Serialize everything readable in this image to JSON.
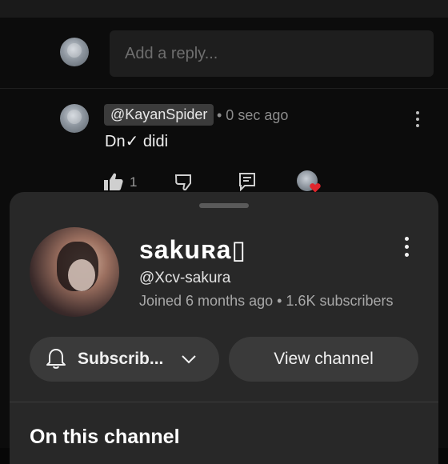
{
  "reply": {
    "placeholder": "Add a reply..."
  },
  "comment": {
    "author": "@KayanSpider",
    "time": "• 0 sec ago",
    "text": "Dn✓ didi",
    "like_count": "1"
  },
  "channel_sheet": {
    "name": "sakuʀa▯",
    "handle": "@Xcv-sakura",
    "meta": "Joined 6 months ago • 1.6K subscribers",
    "subscribe_label": "Subscrib...",
    "view_channel_label": "View channel",
    "section_title": "On this channel"
  },
  "icons": [
    "bell-icon",
    "chevron-down-icon",
    "like-icon",
    "dislike-icon",
    "reply-icon",
    "heart-icon",
    "more-vertical-icon"
  ],
  "colors": {
    "background": "#0c0c0c",
    "sheet": "#282828",
    "pill": "#3a3a3a",
    "heart": "#e0262d"
  }
}
